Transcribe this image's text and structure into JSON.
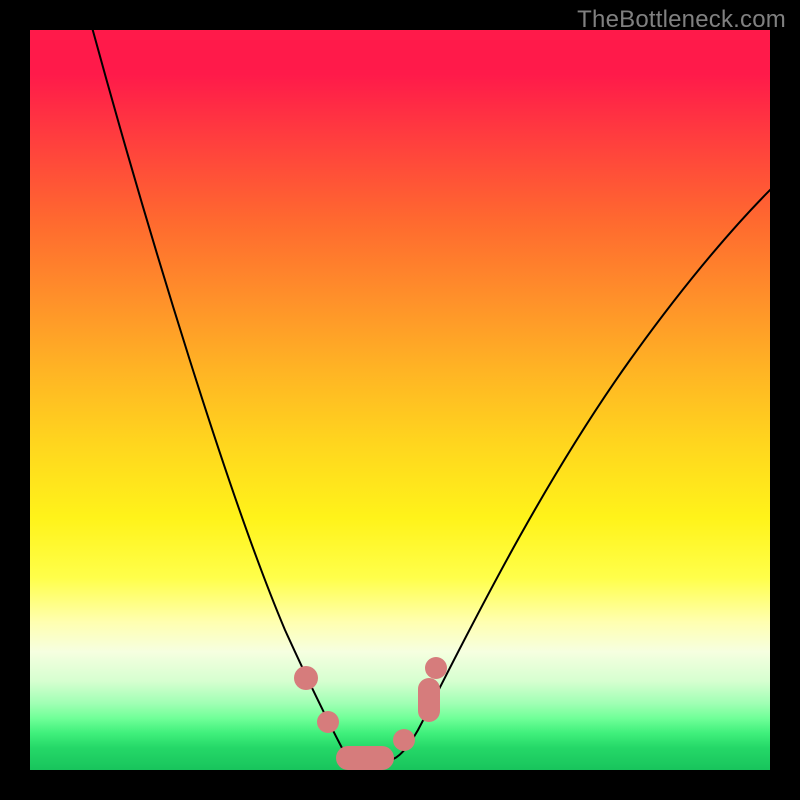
{
  "watermark": "TheBottleneck.com",
  "colors": {
    "frame": "#000000",
    "watermark": "#808080",
    "curve": "#000000",
    "markers": "#d67c7c",
    "gradient_stops": [
      "#ff1a4a",
      "#ff6a2f",
      "#ffd61e",
      "#ffff4a",
      "#f6ffe0",
      "#70ff98",
      "#18c45c"
    ]
  },
  "chart_data": {
    "type": "line",
    "title": "",
    "xlabel": "",
    "ylabel": "",
    "xlim": [
      0,
      100
    ],
    "ylim": [
      0,
      100
    ],
    "grid": false,
    "legend": false,
    "background": "vertical heat gradient (red top → green bottom)",
    "series": [
      {
        "name": "bottleneck-curve",
        "x": [
          8,
          14,
          20,
          26,
          32,
          37,
          41,
          44,
          46,
          49,
          52,
          57,
          64,
          72,
          82,
          92,
          100
        ],
        "y": [
          100,
          78,
          58,
          42,
          28,
          17,
          9,
          4,
          1,
          1,
          4,
          12,
          26,
          42,
          60,
          74,
          80
        ]
      }
    ],
    "markers": {
      "name": "valley-cluster",
      "color": "#d67c7c",
      "points": [
        {
          "x": 37,
          "y": 13
        },
        {
          "x": 40,
          "y": 7
        },
        {
          "x": 43,
          "y": 2
        },
        {
          "x": 46,
          "y": 1
        },
        {
          "x": 49,
          "y": 1
        },
        {
          "x": 51,
          "y": 4
        },
        {
          "x": 53,
          "y": 10
        },
        {
          "x": 55,
          "y": 14
        }
      ]
    }
  }
}
